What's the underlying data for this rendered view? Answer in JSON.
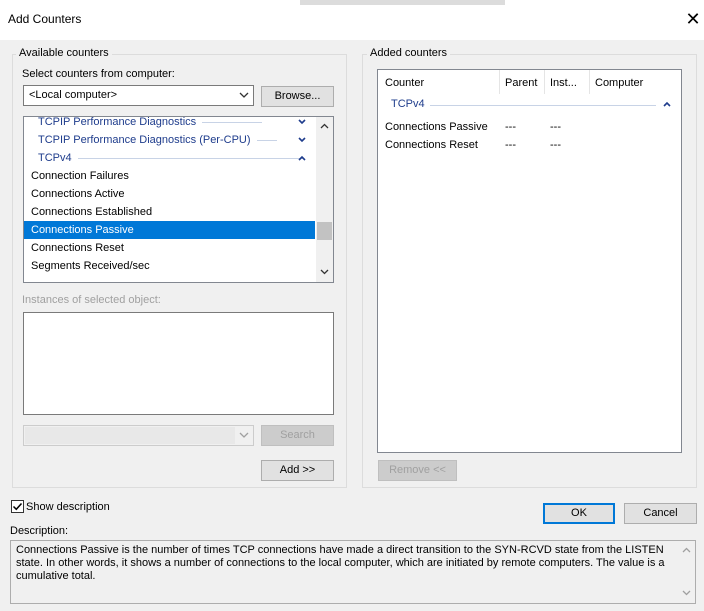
{
  "window": {
    "title": "Add Counters",
    "close_glyph": "✕"
  },
  "available": {
    "group_label": "Available counters",
    "computer_label": "Select counters from computer:",
    "computer_value": "<Local computer>",
    "browse_label": "Browse...",
    "counter_list": [
      {
        "label": "TCPIP Performance Diagnostics",
        "kind": "category",
        "expander": "chevron-down-icon"
      },
      {
        "label": "TCPIP Performance Diagnostics (Per-CPU)",
        "kind": "category",
        "expander": "chevron-down-icon"
      },
      {
        "label": "TCPv4",
        "kind": "category",
        "expander": "chevron-up-icon"
      },
      {
        "label": "Connection Failures",
        "kind": "item"
      },
      {
        "label": "Connections Active",
        "kind": "item"
      },
      {
        "label": "Connections Established",
        "kind": "item"
      },
      {
        "label": "Connections Passive",
        "kind": "item",
        "selected": true
      },
      {
        "label": "Connections Reset",
        "kind": "item"
      },
      {
        "label": "Segments Received/sec",
        "kind": "item"
      }
    ],
    "instances_label": "Instances of selected object:",
    "search_label": "Search",
    "add_label": "Add >>"
  },
  "added": {
    "group_label": "Added counters",
    "columns": [
      "Counter",
      "Parent",
      "Inst...",
      "Computer"
    ],
    "category": "TCPv4",
    "rows": [
      {
        "counter": "Connections Passive",
        "parent": "---",
        "instance": "---",
        "computer": ""
      },
      {
        "counter": "Connections Reset",
        "parent": "---",
        "instance": "---",
        "computer": ""
      }
    ],
    "remove_label": "Remove <<"
  },
  "footer": {
    "show_description_label": "Show description",
    "show_description_checked": true,
    "ok_label": "OK",
    "cancel_label": "Cancel",
    "description_label": "Description:",
    "description_text": "Connections Passive is the number of times TCP connections have made a direct transition to the SYN-RCVD state from the LISTEN state. In other words, it shows a number of connections to the local computer, which are initiated by remote computers. The value is a cumulative total."
  },
  "colors": {
    "accent": "#0078d7",
    "category_text": "#1e3c8c"
  }
}
